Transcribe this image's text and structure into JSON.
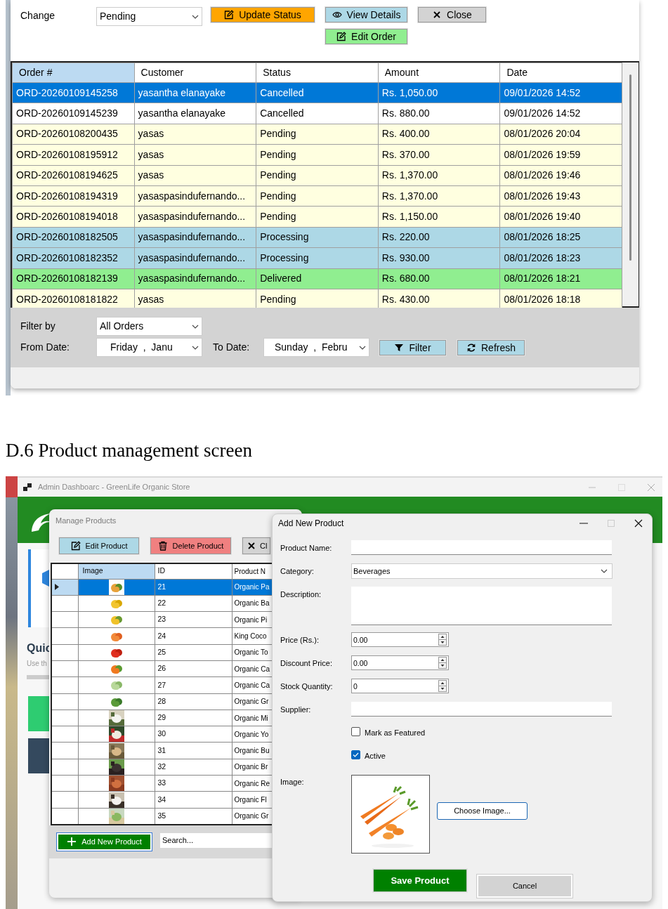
{
  "orders": {
    "toolbar": {
      "change_label": "Change",
      "status_select": {
        "value": "Pending"
      },
      "buttons": [
        {
          "label": "Update Status",
          "kind": "update"
        },
        {
          "label": "View Details",
          "kind": "view"
        },
        {
          "label": "Edit Order",
          "kind": "edit"
        },
        {
          "label": "Close",
          "kind": "close"
        }
      ]
    },
    "table": {
      "columns": [
        "Order #",
        "Customer",
        "Status",
        "Amount",
        "Date"
      ],
      "rows": [
        {
          "order": "ORD-20260109145258",
          "customer": "yasantha elanayake",
          "status": "Cancelled",
          "amount": "Rs. 1,050.00",
          "date": "09/01/2026 14:52",
          "selected": true
        },
        {
          "order": "ORD-20260109145239",
          "customer": "yasantha elanayake",
          "status": "Cancelled",
          "amount": "Rs. 880.00",
          "date": "09/01/2026 14:52",
          "selected": false,
          "color": "#ffffff"
        },
        {
          "order": "ORD-20260108200435",
          "customer": "yasas",
          "status": "Pending",
          "amount": "Rs. 400.00",
          "date": "08/01/2026 20:04",
          "selected": false,
          "color": "#ffffe0"
        },
        {
          "order": "ORD-20260108195912",
          "customer": "yasas",
          "status": "Pending",
          "amount": "Rs. 370.00",
          "date": "08/01/2026 19:59",
          "selected": false,
          "color": "#ffffe0"
        },
        {
          "order": "ORD-20260108194625",
          "customer": "yasas",
          "status": "Pending",
          "amount": "Rs. 1,370.00",
          "date": "08/01/2026 19:46",
          "selected": false,
          "color": "#ffffe0"
        },
        {
          "order": "ORD-20260108194319",
          "customer": "yasaspasindufernando...",
          "status": "Pending",
          "amount": "Rs. 1,370.00",
          "date": "08/01/2026 19:43",
          "selected": false,
          "color": "#ffffe0"
        },
        {
          "order": "ORD-20260108194018",
          "customer": "yasaspasindufernando...",
          "status": "Pending",
          "amount": "Rs. 1,150.00",
          "date": "08/01/2026 19:40",
          "selected": false,
          "color": "#ffffe0"
        },
        {
          "order": "ORD-20260108182505",
          "customer": "yasaspasindufernando...",
          "status": "Processing",
          "amount": "Rs. 220.00",
          "date": "08/01/2026 18:25",
          "selected": false,
          "color": "#add8e6"
        },
        {
          "order": "ORD-20260108182352",
          "customer": "yasaspasindufernando...",
          "status": "Processing",
          "amount": "Rs. 930.00",
          "date": "08/01/2026 18:23",
          "selected": false,
          "color": "#add8e6"
        },
        {
          "order": "ORD-20260108182139",
          "customer": "yasaspasindufernando...",
          "status": "Delivered",
          "amount": "Rs. 680.00",
          "date": "08/01/2026 18:21",
          "selected": false,
          "color": "#90ee90"
        },
        {
          "order": "ORD-20260108181822",
          "customer": "yasas",
          "status": "Pending",
          "amount": "Rs. 430.00",
          "date": "08/01/2026 18:18",
          "selected": false,
          "color": "#ffffe0"
        }
      ]
    },
    "filter": {
      "filter_label": "Filter by",
      "filter_select": {
        "value": "All Orders"
      },
      "from_label": "From Date:",
      "from_date": {
        "value": "Friday  ,  Janu"
      },
      "to_label": "To Date:",
      "to_date": {
        "value": "Sunday  ,  Febru"
      },
      "buttons": [
        {
          "label": "Filter",
          "kind": "filter"
        },
        {
          "label": "Refresh",
          "kind": "refresh"
        }
      ]
    }
  },
  "heading": "D.6 Product management screen",
  "products": {
    "window_title": "Admin Dashboarc - GreenLife Organic Store",
    "background": {
      "quick_title": "Quic",
      "quick_subtitle": "Use th"
    },
    "manage": {
      "title": "Manage Products",
      "buttons": [
        {
          "label": "Edit Product",
          "kind": "edit_product"
        },
        {
          "label": "Delete Product",
          "kind": "delete"
        },
        {
          "label": "Cl",
          "kind": "close_product"
        }
      ],
      "table": {
        "columns": [
          "Image",
          "ID",
          "Product N"
        ],
        "rows": [
          {
            "id": "21",
            "name": "Organic Pa",
            "selected": true
          },
          {
            "id": "22",
            "name": "Organic Ba",
            "selected": false
          },
          {
            "id": "23",
            "name": "Organic Pi",
            "selected": false
          },
          {
            "id": "24",
            "name": "King Coco",
            "selected": false
          },
          {
            "id": "25",
            "name": "Organic To",
            "selected": false
          },
          {
            "id": "26",
            "name": "Organic Ca",
            "selected": false
          },
          {
            "id": "27",
            "name": "Organic Ca",
            "selected": false
          },
          {
            "id": "28",
            "name": "Organic Gr",
            "selected": false
          },
          {
            "id": "29",
            "name": "Organic Mi",
            "selected": false
          },
          {
            "id": "30",
            "name": "Organic Yo",
            "selected": false
          },
          {
            "id": "31",
            "name": "Organic Bu",
            "selected": false
          },
          {
            "id": "32",
            "name": "Organic Br",
            "selected": false
          },
          {
            "id": "33",
            "name": "Organic Re",
            "selected": false
          },
          {
            "id": "34",
            "name": "Organic Fl",
            "selected": false
          },
          {
            "id": "35",
            "name": "Organic Gr",
            "selected": false
          }
        ]
      },
      "add_button": {
        "label": "Add New Product",
        "kind": "add"
      },
      "search": {
        "value": "Search..."
      }
    },
    "dialog": {
      "title": "Add New Product",
      "fields": [
        {
          "label": "Product Name:",
          "kind": "text"
        },
        {
          "label": "Category:",
          "kind": "select",
          "value": "Beverages"
        },
        {
          "label": "Description:",
          "kind": "textarea"
        },
        {
          "label": "Price (Rs.):",
          "kind": "spinner",
          "value": "0.00"
        },
        {
          "label": "Discount Price:",
          "kind": "spinner",
          "value": "0.00"
        },
        {
          "label": "Stock Quantity:",
          "kind": "spinner",
          "value": "0"
        },
        {
          "label": "Supplier:",
          "kind": "text"
        }
      ],
      "checkboxes": [
        {
          "label": "Mark as Featured",
          "checked": false
        },
        {
          "label": "Active",
          "checked": true
        }
      ],
      "image_label": "Image:",
      "choose_button": "Choose Image...",
      "save_button": "Save Product",
      "cancel_button": "Cancel"
    }
  }
}
